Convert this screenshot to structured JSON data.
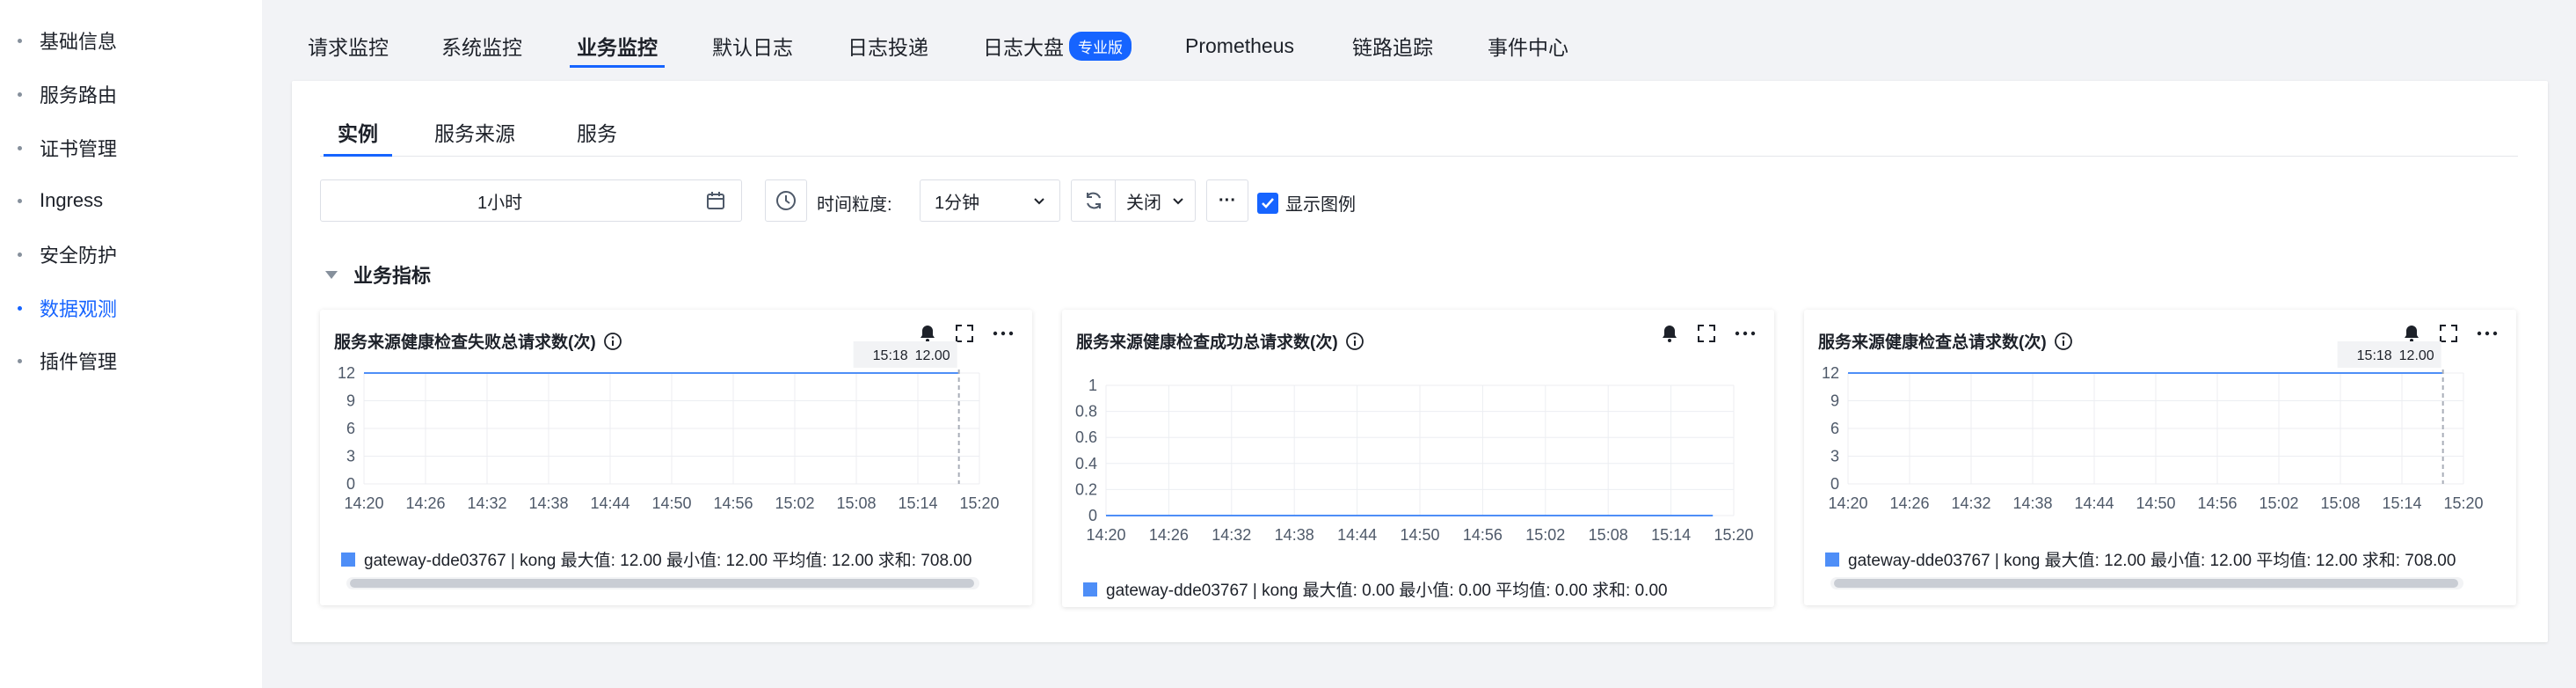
{
  "sidebar": {
    "items": [
      {
        "label": "基础信息"
      },
      {
        "label": "服务路由"
      },
      {
        "label": "证书管理"
      },
      {
        "label": "Ingress"
      },
      {
        "label": "安全防护"
      },
      {
        "label": "数据观测",
        "active": true
      },
      {
        "label": "插件管理"
      }
    ]
  },
  "topnav": {
    "tabs": [
      {
        "label": "请求监控"
      },
      {
        "label": "系统监控"
      },
      {
        "label": "业务监控",
        "active": true
      },
      {
        "label": "默认日志"
      },
      {
        "label": "日志投递"
      },
      {
        "label": "日志大盘",
        "badge": "专业版"
      },
      {
        "label": "Prometheus"
      },
      {
        "label": "链路追踪"
      },
      {
        "label": "事件中心"
      }
    ]
  },
  "subtabs": [
    {
      "label": "实例",
      "active": true
    },
    {
      "label": "服务来源"
    },
    {
      "label": "服务"
    }
  ],
  "toolbar": {
    "time_range": "1小时",
    "granularity_label": "时间粒度:",
    "granularity_value": "1分钟",
    "refresh_value": "关闭",
    "more": "···",
    "show_legend_label": "显示图例",
    "show_legend_checked": true
  },
  "section": {
    "title": "业务指标"
  },
  "colors": {
    "accent": "#1664ff",
    "series": "#4e8ef7"
  },
  "icons": [
    "calendar-icon",
    "clock-icon",
    "refresh-icon",
    "chevron-down-icon",
    "bell-icon",
    "fullscreen-icon",
    "more-icon",
    "info-icon",
    "checkbox-icon"
  ],
  "charts": [
    {
      "title": "服务来源健康检查失败总请求数(次)",
      "tooltip_time": "15:18",
      "tooltip_value": "12.00",
      "legend": "gateway-dde03767 | kong  最大值: 12.00  最小值: 12.00  平均值: 12.00  求和: 708.00"
    },
    {
      "title": "服务来源健康检查成功总请求数(次)",
      "legend": "gateway-dde03767 | kong  最大值: 0.00  最小值: 0.00  平均值: 0.00  求和: 0.00"
    },
    {
      "title": "服务来源健康检查总请求数(次)",
      "tooltip_time": "15:18",
      "tooltip_value": "12.00",
      "legend": "gateway-dde03767 | kong  最大值: 12.00  最小值: 12.00  平均值: 12.00  求和: 708.00"
    }
  ],
  "chart_data": [
    {
      "type": "line",
      "title": "服务来源健康检查失败总请求数(次)",
      "x": [
        "14:20",
        "14:26",
        "14:32",
        "14:38",
        "14:44",
        "14:50",
        "14:56",
        "15:02",
        "15:08",
        "15:14",
        "15:20"
      ],
      "yticks": [
        "0",
        "3",
        "6",
        "9",
        "12"
      ],
      "ylim": [
        0,
        12
      ],
      "series": [
        {
          "name": "gateway-dde03767 | kong",
          "x_range": [
            "14:20",
            "15:18"
          ],
          "value": 12
        }
      ],
      "tooltip": {
        "x": "15:18",
        "y": 12
      },
      "grid": true
    },
    {
      "type": "line",
      "title": "服务来源健康检查成功总请求数(次)",
      "x": [
        "14:20",
        "14:26",
        "14:32",
        "14:38",
        "14:44",
        "14:50",
        "14:56",
        "15:02",
        "15:08",
        "15:14",
        "15:20"
      ],
      "yticks": [
        "0",
        "0.2",
        "0.4",
        "0.6",
        "0.8",
        "1"
      ],
      "ylim": [
        0,
        1
      ],
      "series": [
        {
          "name": "gateway-dde03767 | kong",
          "x_range": [
            "14:20",
            "15:18"
          ],
          "value": 0
        }
      ],
      "grid": true
    },
    {
      "type": "line",
      "title": "服务来源健康检查总请求数(次)",
      "x": [
        "14:20",
        "14:26",
        "14:32",
        "14:38",
        "14:44",
        "14:50",
        "14:56",
        "15:02",
        "15:08",
        "15:14",
        "15:20"
      ],
      "yticks": [
        "0",
        "3",
        "6",
        "9",
        "12"
      ],
      "ylim": [
        0,
        12
      ],
      "series": [
        {
          "name": "gateway-dde03767 | kong",
          "x_range": [
            "14:20",
            "15:18"
          ],
          "value": 12
        }
      ],
      "tooltip": {
        "x": "15:18",
        "y": 12
      },
      "grid": true
    }
  ]
}
